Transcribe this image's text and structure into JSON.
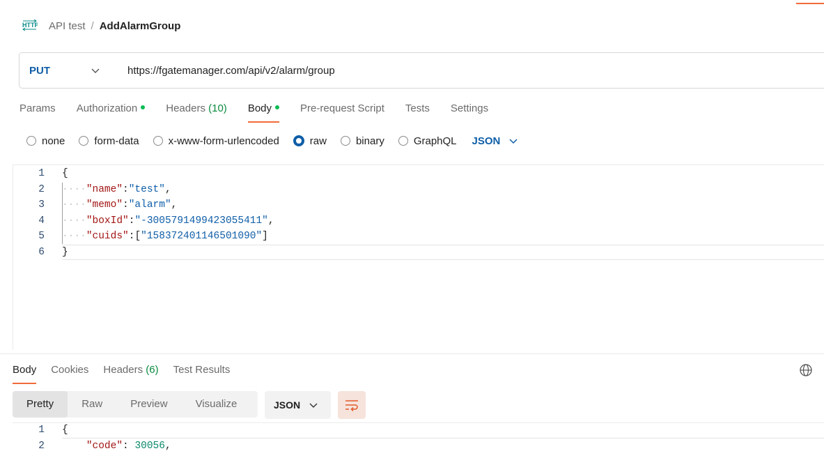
{
  "breadcrumb": {
    "icon": "http-icon",
    "parent": "API test",
    "separator": "/",
    "current": "AddAlarmGroup"
  },
  "request": {
    "method": "PUT",
    "url": "https://fgatemanager.com/api/v2/alarm/group"
  },
  "request_tabs": [
    {
      "label": "Params"
    },
    {
      "label": "Authorization",
      "dot": true
    },
    {
      "label": "Headers",
      "count": "(10)"
    },
    {
      "label": "Body",
      "dot": true,
      "active": true
    },
    {
      "label": "Pre-request Script"
    },
    {
      "label": "Tests"
    },
    {
      "label": "Settings"
    }
  ],
  "body_types": {
    "options": [
      "none",
      "form-data",
      "x-www-form-urlencoded",
      "raw",
      "binary",
      "GraphQL"
    ],
    "selected": "raw",
    "format": "JSON"
  },
  "editor": {
    "line_numbers": [
      "1",
      "2",
      "3",
      "4",
      "5",
      "6"
    ],
    "lines": [
      {
        "open": "{"
      },
      {
        "key": "\"name\"",
        "value": "\"test\"",
        "trail": ","
      },
      {
        "key": "\"memo\"",
        "value": "\"alarm\"",
        "trail": ","
      },
      {
        "key": "\"boxId\"",
        "value": "\"-3005791499423055411\"",
        "trail": ","
      },
      {
        "key": "\"cuids\"",
        "value_prefix": "[",
        "value": "\"158372401146501090\"",
        "value_suffix": "]"
      },
      {
        "close": "}"
      }
    ]
  },
  "response_tabs": [
    {
      "label": "Body",
      "active": true
    },
    {
      "label": "Cookies"
    },
    {
      "label": "Headers",
      "count": "(6)"
    },
    {
      "label": "Test Results"
    }
  ],
  "response_views": [
    "Pretty",
    "Raw",
    "Preview",
    "Visualize"
  ],
  "response_view_selected": "Pretty",
  "response_format": "JSON",
  "response_editor": {
    "line_numbers": [
      "1",
      "2"
    ],
    "line1": "{",
    "line2_key": "\"code\"",
    "line2_colon": ":",
    "line2_value": "30056",
    "line2_trail": ","
  },
  "colors": {
    "accent": "#f26b3a",
    "method": "#0f5ea8",
    "dot": "#0cbb52",
    "json_key": "#a31515",
    "json_string": "#0f5ea8"
  }
}
